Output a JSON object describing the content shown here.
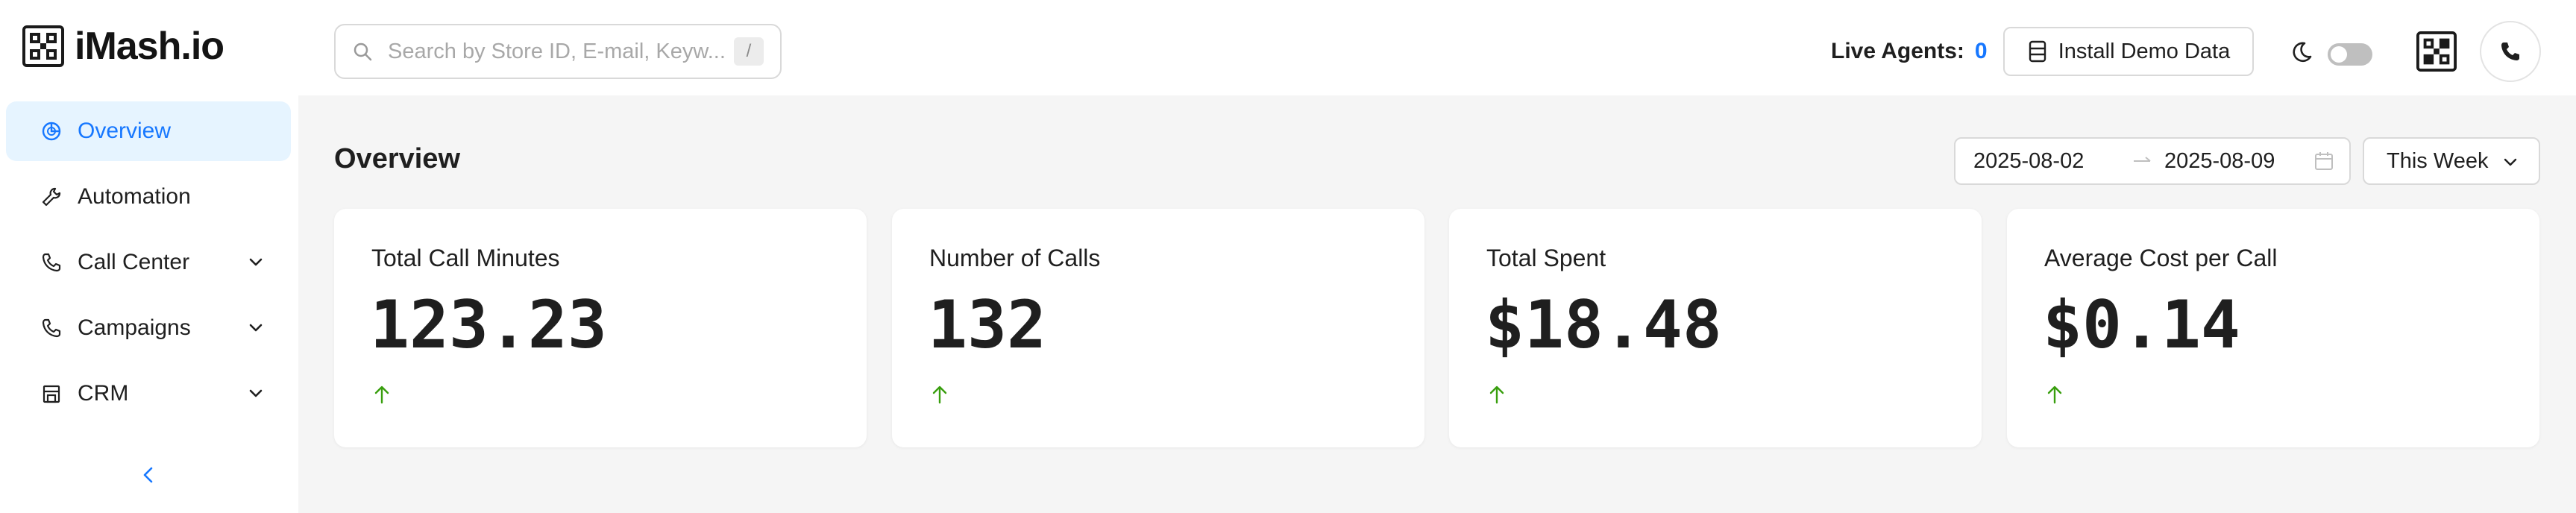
{
  "brand": {
    "name": "iMash.io"
  },
  "search": {
    "placeholder": "Search by Store ID, E-mail, Keyw...",
    "shortcut": "/"
  },
  "header": {
    "live_agents_label": "Live Agents:",
    "live_agents_count": "0",
    "install_demo_label": "Install Demo Data",
    "dark_mode": false
  },
  "sidebar": {
    "items": [
      {
        "label": "Overview",
        "icon": "pie-chart-icon",
        "active": true,
        "expandable": false
      },
      {
        "label": "Automation",
        "icon": "tool-icon",
        "active": false,
        "expandable": false
      },
      {
        "label": "Call Center",
        "icon": "phone-icon",
        "active": false,
        "expandable": true
      },
      {
        "label": "Campaigns",
        "icon": "phone-icon",
        "active": false,
        "expandable": true
      },
      {
        "label": "CRM",
        "icon": "store-icon",
        "active": false,
        "expandable": true
      }
    ]
  },
  "main": {
    "title": "Overview",
    "date_range": {
      "start": "2025-08-02",
      "end": "2025-08-09"
    },
    "period": "This Week",
    "cards": [
      {
        "label": "Total Call Minutes",
        "value": "123.23",
        "trend": "up"
      },
      {
        "label": "Number of Calls",
        "value": "132",
        "trend": "up"
      },
      {
        "label": "Total Spent",
        "value": "$18.48",
        "trend": "up"
      },
      {
        "label": "Average Cost per Call",
        "value": "$0.14",
        "trend": "up"
      }
    ]
  },
  "colors": {
    "accent": "#1677ff",
    "active_bg": "#e6f4ff",
    "trend_up": "#389e0d",
    "main_bg": "#f5f5f5"
  }
}
